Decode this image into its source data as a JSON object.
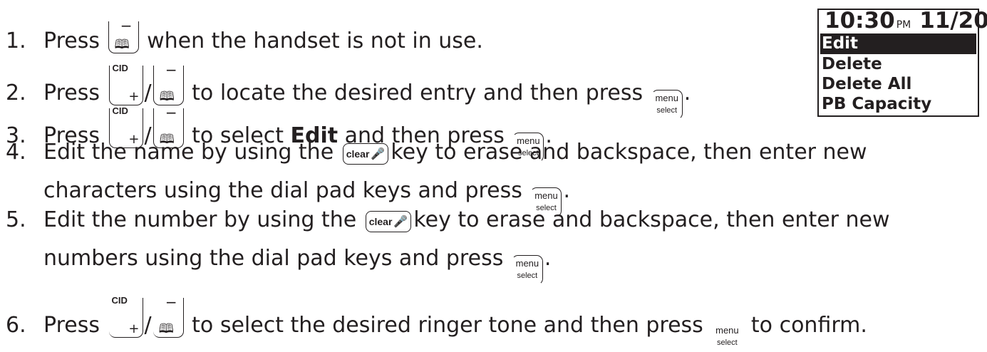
{
  "icons": {
    "cid_key": "cid-plus-key-icon",
    "phonebook_key": "phonebook-minus-key-icon",
    "menu_key": "menu-select-key-icon",
    "clear_key": "clear-mute-key-icon"
  },
  "keys": {
    "cid": "CID",
    "plus": "+",
    "minus": "−",
    "menu": "menu",
    "select": "select",
    "clear": "clear",
    "slash": "/"
  },
  "steps": [
    {
      "num": "1.",
      "a": "Press",
      "b": "when the handset is not in use."
    },
    {
      "num": "2.",
      "a": "Press",
      "b": "to locate the desired entry and then press",
      "c": "."
    },
    {
      "num": "3.",
      "a": "Press",
      "b": "to select ",
      "bold": "Edit",
      "c": " and then press",
      "d": "."
    },
    {
      "num": "4.",
      "a": "Edit the name by using the",
      "b": "key to erase and backspace, then enter new",
      "line2": "characters using the dial pad keys and press",
      "c": "."
    },
    {
      "num": "5.",
      "a": "Edit the number by using the",
      "b": "key to erase and backspace, then enter new",
      "line2": "numbers using the dial pad keys and press",
      "c": "."
    },
    {
      "num": "6.",
      "a": "Press",
      "b": "to select the desired ringer tone and then press",
      "c": "to confirm."
    }
  ],
  "lcd": {
    "time": "10:30",
    "ampm": "PM",
    "date": "11/20",
    "items": [
      "Edit",
      "Delete",
      "Delete All",
      "PB Capacity"
    ],
    "selected_index": 0
  },
  "colors": {
    "text": "#231f20",
    "background": "#ffffff",
    "highlight": "#231f20"
  }
}
